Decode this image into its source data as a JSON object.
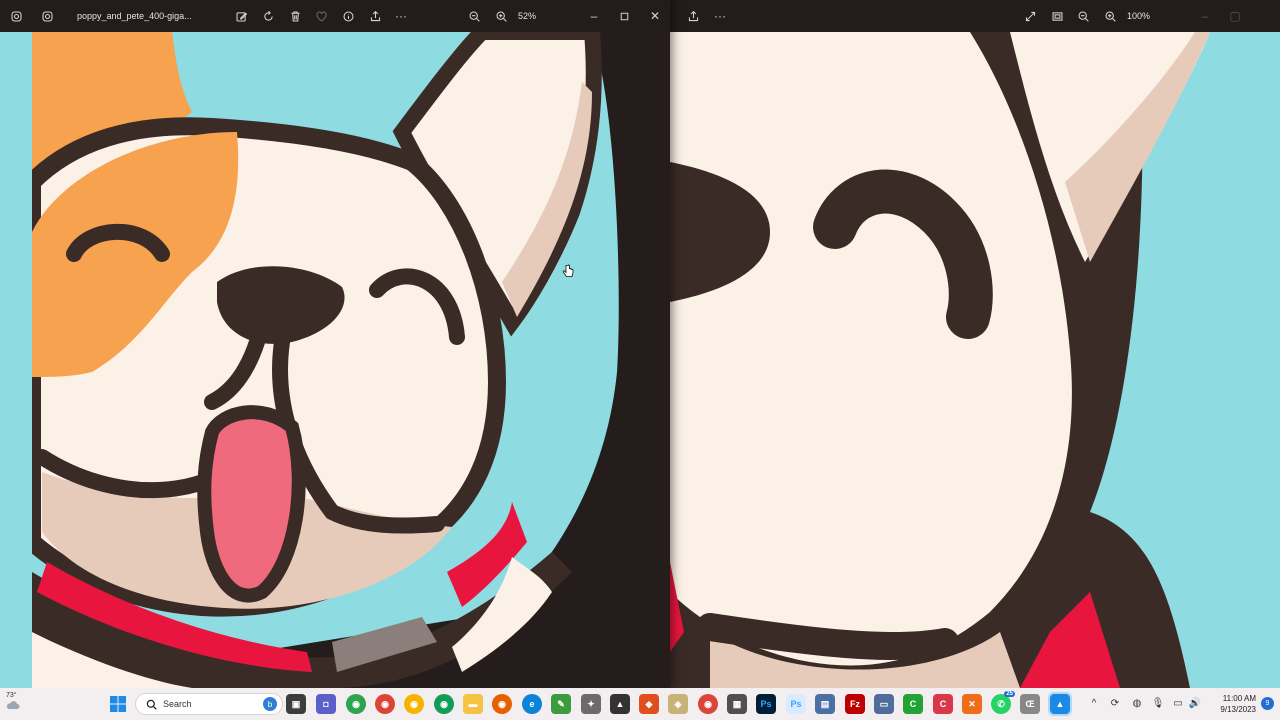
{
  "front_window": {
    "title": "poppy_and_pete_400-giga...",
    "zoom": "52%",
    "toolbar": [
      "edit-icon",
      "rotate-icon",
      "delete-icon",
      "favorite-icon",
      "info-icon",
      "share-icon",
      "more-icon"
    ],
    "zoom_out_icon": "zoom-out-icon",
    "zoom_in_icon": "zoom-in-icon"
  },
  "back_window": {
    "zoom": "100%"
  },
  "taskbar": {
    "weather": "73°",
    "search_label": "Search",
    "clock_time": "11:00 AM",
    "clock_date": "9/13/2023",
    "notification_count": "9",
    "whatsapp_badge": "25"
  },
  "colors": {
    "sky": "#8fdbe2",
    "outline": "#3b2b27",
    "cream": "#fbf1e6",
    "orange": "#f7a24f",
    "tongue": "#f06a7e",
    "collar": "#e8163e",
    "taskbar_bg": "#f3eeef"
  }
}
